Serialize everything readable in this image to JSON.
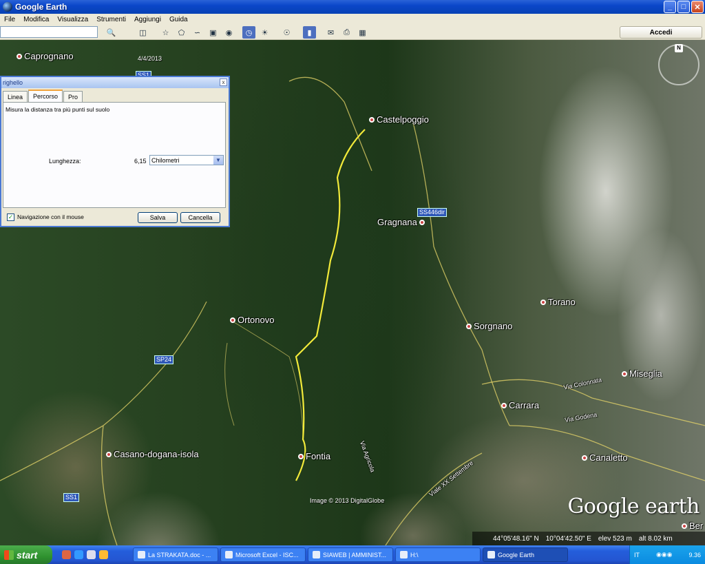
{
  "window": {
    "title": "Google Earth",
    "minimize": "_",
    "maximize": "□",
    "close": "✕"
  },
  "menu": [
    "File",
    "Modifica",
    "Visualizza",
    "Strumenti",
    "Aggiungi",
    "Guida"
  ],
  "toolbar": {
    "search_value": "",
    "sign_in_label": "Accedi"
  },
  "ruler": {
    "title": "righello",
    "close": "x",
    "tabs": [
      "Linea",
      "Percorso",
      "Pro"
    ],
    "active_tab": "Percorso",
    "description": "Misura la distanza tra più punti sul suolo",
    "length_label": "Lunghezza:",
    "length_value": "6,15",
    "unit_selected": "Chilometri",
    "mouse_nav_label": "Navigazione con il mouse",
    "mouse_nav_checked": true,
    "save_label": "Salva",
    "cancel_label": "Cancella"
  },
  "map": {
    "date": "4/4/2013",
    "places": [
      "Caprognano",
      "Castelpoggio",
      "Gragnana",
      "Ortonovo",
      "Torano",
      "Sorgnano",
      "Miseglia",
      "Carrara",
      "Casano-dogana-isola",
      "Fontia",
      "Canaletto",
      "Ber"
    ],
    "road_labels": [
      "SS446dir",
      "SP24",
      "SS1",
      "SS1",
      "Via Colonnata",
      "Via Godena",
      "Viale XX Settembre",
      "Via Agricola"
    ],
    "credit": "Image © 2013 DigitalGlobe",
    "logo": "Google earth",
    "status": {
      "lat": "44°05'48.16\" N",
      "lon": "10°04'42.50\" E",
      "elev": "elev  523 m",
      "alt": "alt  8.02 km"
    },
    "compass_label": "N"
  },
  "taskbar": {
    "start_label": "start",
    "tasks": [
      "La STRAKATA.doc - ...",
      "Microsoft Excel - ISC...",
      "SIAWEB | AMMINIST...",
      "H:\\",
      "Google Earth"
    ],
    "active_task": "Google Earth",
    "language": "IT",
    "clock": "9.36"
  }
}
